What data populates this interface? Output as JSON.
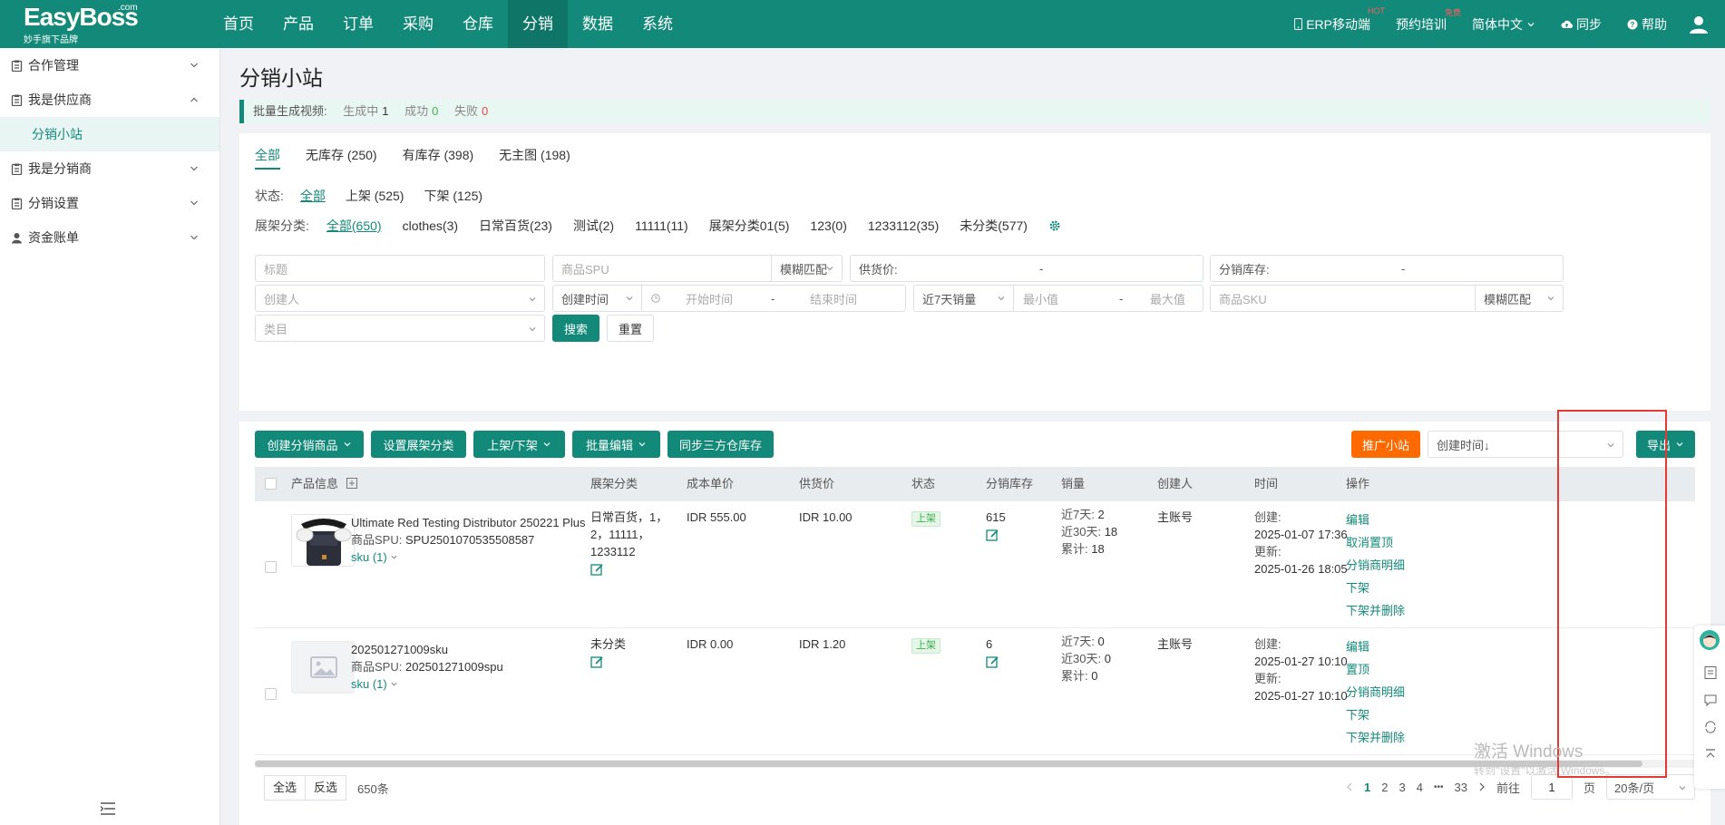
{
  "topnav": {
    "brand": "EasyBoss",
    "brand_suffix": ".com",
    "brand_sub": "妙手旗下品牌",
    "menu": [
      "首页",
      "产品",
      "订单",
      "采购",
      "仓库",
      "分销",
      "数据",
      "系统"
    ],
    "active_menu": "分销",
    "right": {
      "erp": "ERP移动端",
      "erp_badge": "HOT",
      "training": "预约培训",
      "training_badge": "免费",
      "language": "简体中文",
      "sync": "同步",
      "help": "帮助"
    }
  },
  "sidebar": {
    "groups": [
      {
        "label": "合作管理",
        "expanded": false
      },
      {
        "label": "我是供应商",
        "expanded": true,
        "children": [
          "分销小站"
        ]
      },
      {
        "label": "我是分销商",
        "expanded": false
      },
      {
        "label": "分销设置",
        "expanded": false
      },
      {
        "label": "资金账单",
        "expanded": false
      }
    ]
  },
  "page": {
    "title": "分销小站",
    "notice": {
      "label": "批量生成视频:",
      "gen_label": "生成中",
      "gen_count": "1",
      "ok_label": "成功",
      "ok_count": "0",
      "fail_label": "失败",
      "fail_count": "0"
    }
  },
  "filters": {
    "tabs": [
      "全部",
      "无库存 (250)",
      "有库存 (398)",
      "无主图 (198)"
    ],
    "status_label": "状态:",
    "status_options": [
      "全部",
      "上架 (525)",
      "下架 (125)"
    ],
    "category_label": "展架分类:",
    "category_options": [
      "全部(650)",
      "clothes(3)",
      "日常百货(23)",
      "测试(2)",
      "11111(11)",
      "展架分类01(5)",
      "123(0)",
      "1233112(35)",
      "未分类(577)"
    ],
    "title_placeholder": "标题",
    "spu_placeholder": "商品SPU",
    "spu_match": "模糊匹配",
    "price_label": "供货价:",
    "stock_label": "分销库存:",
    "creator_placeholder": "创建人",
    "time_type": "创建时间",
    "start_placeholder": "开始时间",
    "end_placeholder": "结束时间",
    "sales_type": "近7天销量",
    "min_placeholder": "最小值",
    "max_placeholder": "最大值",
    "sku_placeholder": "商品SKU",
    "sku_match": "模糊匹配",
    "category_placeholder": "类目",
    "search_btn": "搜索",
    "reset_btn": "重置",
    "dash": "-"
  },
  "toolbar": {
    "create": "创建分销商品",
    "set_category": "设置展架分类",
    "shelf": "上架/下架",
    "batch_edit": "批量编辑",
    "sync_stock": "同步三方仓库存",
    "promote": "推广小站",
    "sort": "创建时间↓",
    "export": "导出"
  },
  "table": {
    "columns": [
      "产品信息",
      "展架分类",
      "成本单价",
      "供货价",
      "状态",
      "分销库存",
      "销量",
      "创建人",
      "时间",
      "操作"
    ],
    "rows": [
      {
        "name": "Ultimate Red Testing Distributor 250221 Plus",
        "spu_label": "商品SPU:",
        "spu": "SPU2501070535508587",
        "sku": "sku (1)",
        "category_lines": [
          "日常百货，1，",
          "2，11111，",
          "1233112"
        ],
        "cost": "IDR 555.00",
        "price": "IDR 10.00",
        "status": "上架",
        "stock": "615",
        "sales_7_label": "近7天:",
        "sales_7": "2",
        "sales_30_label": "近30天:",
        "sales_30": "18",
        "sales_total_label": "累计:",
        "sales_total": "18",
        "creator": "主账号",
        "created_label": "创建:",
        "created": "2025-01-07 17:36",
        "updated_label": "更新:",
        "updated": "2025-01-26 18:05",
        "actions": [
          "编辑",
          "取消置顶",
          "分销商明细",
          "下架",
          "下架并删除"
        ]
      },
      {
        "name": "202501271009sku",
        "spu_label": "商品SPU:",
        "spu": "202501271009spu",
        "sku": "sku (1)",
        "category_lines": [
          "未分类"
        ],
        "cost": "IDR 0.00",
        "price": "IDR 1.20",
        "status": "上架",
        "stock": "6",
        "sales_7_label": "近7天:",
        "sales_7": "0",
        "sales_30_label": "近30天:",
        "sales_30": "0",
        "sales_total_label": "累计:",
        "sales_total": "0",
        "creator": "主账号",
        "created_label": "创建:",
        "created": "2025-01-27 10:10",
        "updated_label": "更新:",
        "updated": "2025-01-27 10:10",
        "actions": [
          "编辑",
          "置顶",
          "分销商明细",
          "下架",
          "下架并删除"
        ]
      }
    ]
  },
  "footer": {
    "select_all": "全选",
    "invert": "反选",
    "total": "650条",
    "pages": [
      "1",
      "2",
      "3",
      "4"
    ],
    "ellipsis": "•••",
    "last_page": "33",
    "goto_label": "前往",
    "goto_value": "1",
    "page_unit": "页",
    "page_size": "20条/页"
  },
  "watermark": {
    "line1": "激活 Windows",
    "line2": "转到\"设置\"以激活 Windows。"
  },
  "colors": {
    "brand": "#138a79",
    "brand_dark": "#0f7566",
    "orange": "#ff6a00",
    "highlight": "#e53935"
  }
}
